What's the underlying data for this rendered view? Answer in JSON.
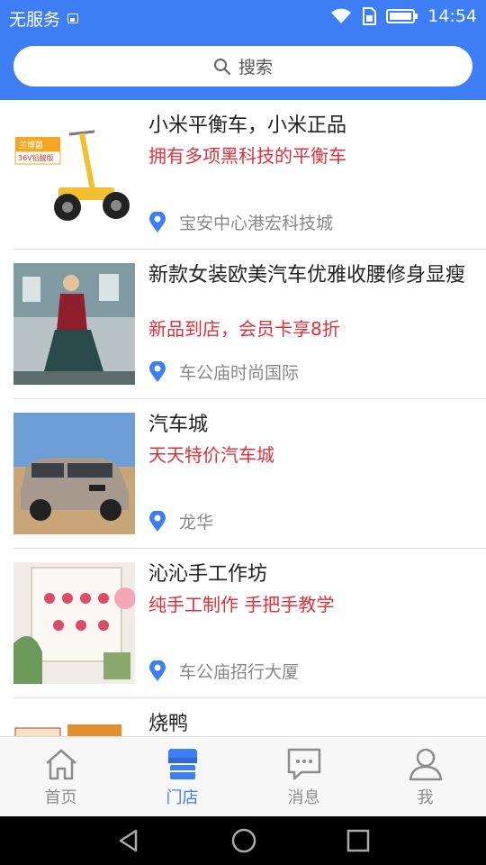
{
  "status": {
    "carrier": "无服务",
    "time": "14:54"
  },
  "search": {
    "label": "搜索"
  },
  "stores": [
    {
      "title": "小米平衡车，小米正品",
      "subtitle": "拥有多项黑科技的平衡车",
      "location": "宝安中心港宏科技城",
      "badge_line1": "兰博菌",
      "badge_line2": "36V铅酸版"
    },
    {
      "title": "新款女装欧美汽车优雅收腰修身显瘦",
      "subtitle": "新品到店，会员卡享8折",
      "location": "车公庙时尚国际"
    },
    {
      "title": "汽车城",
      "subtitle": "天天特价汽车城",
      "location": "龙华"
    },
    {
      "title": "沁沁手工作坊",
      "subtitle": "纯手工制作 手把手教学",
      "location": "车公庙招行大厦"
    },
    {
      "title": "烧鸭",
      "subtitle": "",
      "location": ""
    }
  ],
  "tabs": [
    {
      "label": "首页",
      "icon": "home-icon",
      "active": false
    },
    {
      "label": "门店",
      "icon": "store-icon",
      "active": true
    },
    {
      "label": "消息",
      "icon": "message-icon",
      "active": false
    },
    {
      "label": "我",
      "icon": "user-icon",
      "active": false
    }
  ],
  "colors": {
    "primary": "#3d7ef5",
    "accent_red": "#e0303a",
    "location_pin": "#3d7ef5"
  }
}
